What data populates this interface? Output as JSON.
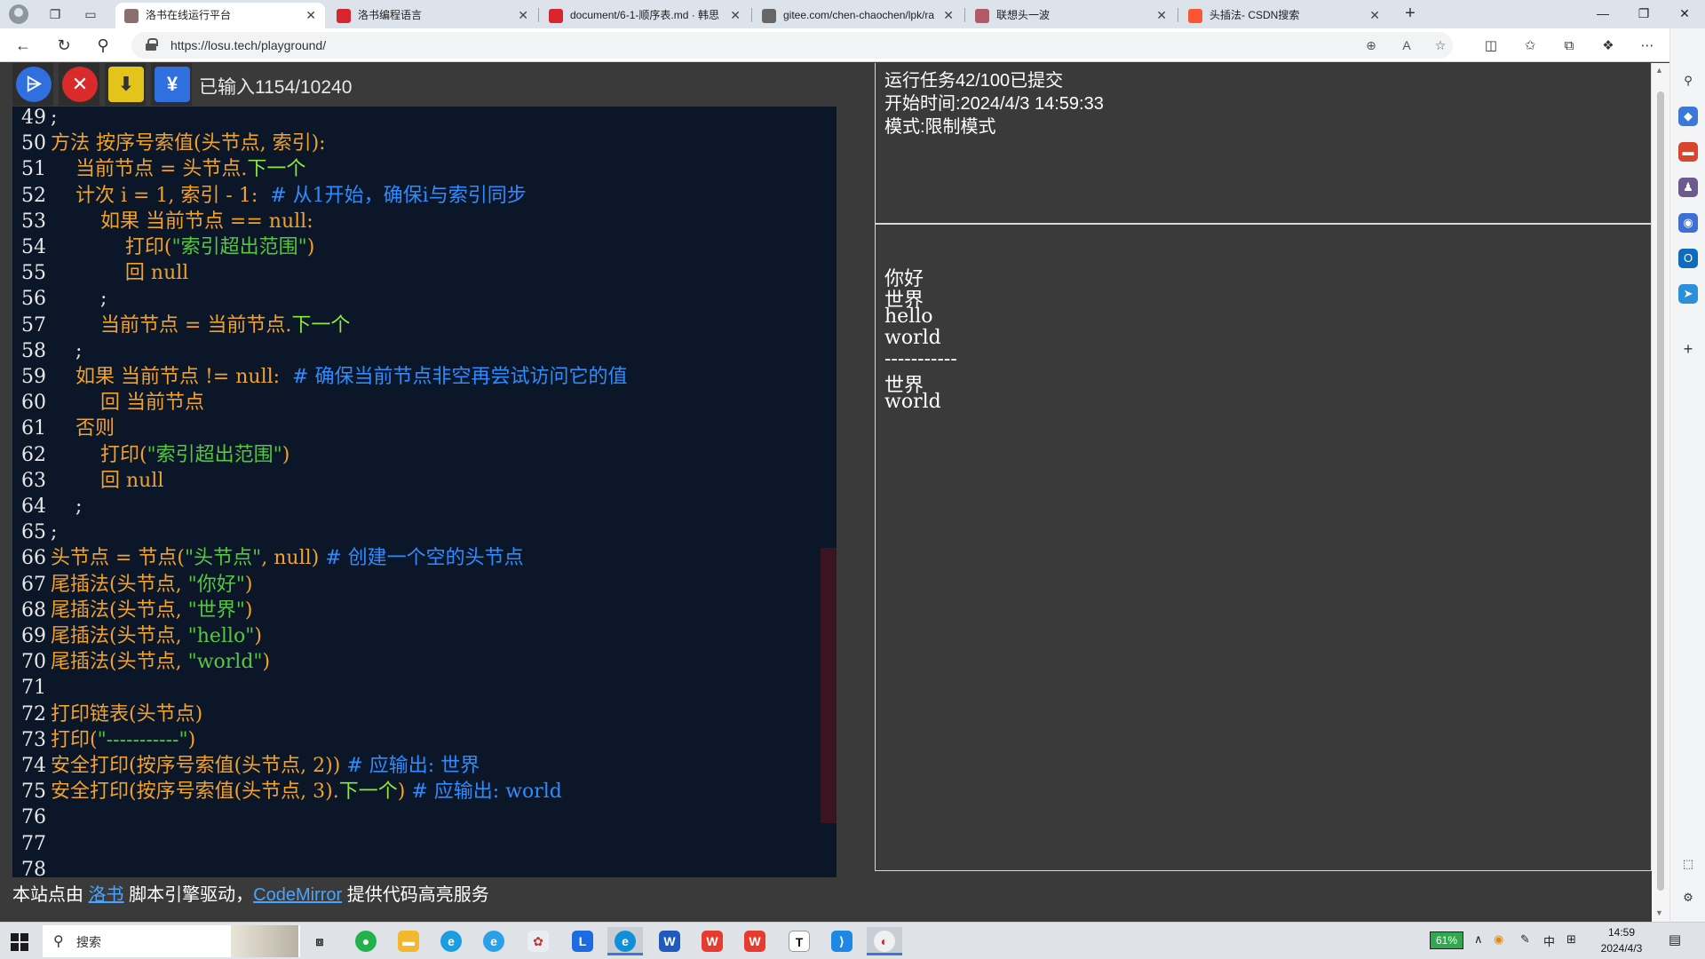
{
  "browser": {
    "tabs": [
      {
        "title": "洛书在线运行平台",
        "active": true,
        "favicon_color": "#8a6f6f"
      },
      {
        "title": "洛书编程语言",
        "active": false,
        "favicon_color": "#d9262e"
      },
      {
        "title": "document/6-1-顺序表.md · 韩思",
        "active": false,
        "favicon_color": "#d9262e"
      },
      {
        "title": "gitee.com/chen-chaochen/lpk/ra",
        "active": false,
        "favicon_color": "#666666"
      },
      {
        "title": "联想头一波",
        "active": false,
        "favicon_color": "#b35a6a"
      },
      {
        "title": "头插法- CSDN搜索",
        "active": false,
        "favicon_color": "#fc5531"
      }
    ],
    "url": "https://losu.tech/playground/"
  },
  "toolbar": {
    "run_icon": "run-icon",
    "stop_icon": "stop-icon",
    "download_icon": "download-icon",
    "lang_icon": "luoshu-icon",
    "input_counter": "已输入1154/10240"
  },
  "editor": {
    "lines": [
      {
        "n": "49",
        "segs": [
          {
            "t": ";",
            "c": "w"
          }
        ]
      },
      {
        "n": "50",
        "segs": [
          {
            "t": "方法 按序号索值(头节点, 索引):",
            "c": "k"
          }
        ]
      },
      {
        "n": "51",
        "segs": [
          {
            "t": "    当前节点 = 头节点.",
            "c": "k"
          },
          {
            "t": "下一个",
            "c": "y"
          }
        ]
      },
      {
        "n": "52",
        "segs": [
          {
            "t": "    计次 i = 1, 索引 - 1:  ",
            "c": "k"
          },
          {
            "t": "# 从1开始，确保i与索引同步",
            "c": "c"
          }
        ]
      },
      {
        "n": "53",
        "segs": [
          {
            "t": "        如果 当前节点 == null:",
            "c": "k"
          }
        ]
      },
      {
        "n": "54",
        "segs": [
          {
            "t": "            打印(",
            "c": "k"
          },
          {
            "t": "\"索引超出范围\"",
            "c": "g"
          },
          {
            "t": ")",
            "c": "k"
          }
        ]
      },
      {
        "n": "55",
        "segs": [
          {
            "t": "            回 null",
            "c": "k"
          }
        ]
      },
      {
        "n": "56",
        "segs": [
          {
            "t": "        ;",
            "c": "w"
          }
        ]
      },
      {
        "n": "57",
        "segs": [
          {
            "t": "        当前节点 = 当前节点.",
            "c": "k"
          },
          {
            "t": "下一个",
            "c": "y"
          }
        ]
      },
      {
        "n": "58",
        "segs": [
          {
            "t": "    ;",
            "c": "w"
          }
        ]
      },
      {
        "n": "59",
        "segs": [
          {
            "t": "    如果 当前节点 != null:  ",
            "c": "k"
          },
          {
            "t": "# 确保当前节点非空再尝试访问它的值",
            "c": "c"
          }
        ]
      },
      {
        "n": "60",
        "segs": [
          {
            "t": "        回 当前节点",
            "c": "k"
          }
        ]
      },
      {
        "n": "61",
        "segs": [
          {
            "t": "    否则",
            "c": "k"
          }
        ]
      },
      {
        "n": "62",
        "segs": [
          {
            "t": "        打印(",
            "c": "k"
          },
          {
            "t": "\"索引超出范围\"",
            "c": "g"
          },
          {
            "t": ")",
            "c": "k"
          }
        ]
      },
      {
        "n": "63",
        "segs": [
          {
            "t": "        回 null",
            "c": "k"
          }
        ]
      },
      {
        "n": "64",
        "segs": [
          {
            "t": "    ;",
            "c": "w"
          }
        ]
      },
      {
        "n": "65",
        "segs": [
          {
            "t": ";",
            "c": "w"
          }
        ]
      },
      {
        "n": "66",
        "segs": [
          {
            "t": "头节点 = 节点(",
            "c": "k"
          },
          {
            "t": "\"头节点\"",
            "c": "g"
          },
          {
            "t": ", null) ",
            "c": "k"
          },
          {
            "t": "# 创建一个空的头节点",
            "c": "c"
          }
        ]
      },
      {
        "n": "67",
        "segs": [
          {
            "t": "尾插法(头节点, ",
            "c": "k"
          },
          {
            "t": "\"你好\"",
            "c": "g"
          },
          {
            "t": ")",
            "c": "k"
          }
        ]
      },
      {
        "n": "68",
        "segs": [
          {
            "t": "尾插法(头节点, ",
            "c": "k"
          },
          {
            "t": "\"世界\"",
            "c": "g"
          },
          {
            "t": ")",
            "c": "k"
          }
        ]
      },
      {
        "n": "69",
        "segs": [
          {
            "t": "尾插法(头节点, ",
            "c": "k"
          },
          {
            "t": "\"hello\"",
            "c": "g"
          },
          {
            "t": ")",
            "c": "k"
          }
        ]
      },
      {
        "n": "70",
        "segs": [
          {
            "t": "尾插法(头节点, ",
            "c": "k"
          },
          {
            "t": "\"world\"",
            "c": "g"
          },
          {
            "t": ")",
            "c": "k"
          }
        ]
      },
      {
        "n": "71",
        "segs": []
      },
      {
        "n": "72",
        "segs": [
          {
            "t": "打印链表(头节点)",
            "c": "k"
          }
        ]
      },
      {
        "n": "73",
        "segs": [
          {
            "t": "打印(",
            "c": "k"
          },
          {
            "t": "\"-----------\"",
            "c": "g"
          },
          {
            "t": ")",
            "c": "k"
          }
        ]
      },
      {
        "n": "74",
        "segs": [
          {
            "t": "安全打印(按序号索值(头节点, 2)) ",
            "c": "k"
          },
          {
            "t": "# 应输出: 世界",
            "c": "c"
          }
        ]
      },
      {
        "n": "75",
        "segs": [
          {
            "t": "安全打印(按序号索值(头节点, 3).",
            "c": "k"
          },
          {
            "t": "下一个",
            "c": "y"
          },
          {
            "t": ") ",
            "c": "k"
          },
          {
            "t": "# 应输出: world",
            "c": "c"
          }
        ]
      },
      {
        "n": "76",
        "segs": []
      },
      {
        "n": "77",
        "segs": []
      },
      {
        "n": "78",
        "segs": []
      }
    ]
  },
  "output": {
    "task_line": "运行任务42/100已提交",
    "start_time": "开始时间:2024/4/3 14:59:33",
    "mode": "模式:限制模式",
    "lines": [
      "你好",
      "世界",
      "hello",
      "world",
      "-----------",
      "世界",
      "world"
    ]
  },
  "footer": {
    "prefix": "本站点由 ",
    "link1": "洛书",
    "middle": " 脚本引擎驱动，",
    "link2": "CodeMirror",
    "suffix": " 提供代码高亮服务"
  },
  "taskbar": {
    "search_label": "搜索",
    "battery": "61%",
    "ime": "中",
    "time": "14:59",
    "date": "2024/4/3"
  }
}
